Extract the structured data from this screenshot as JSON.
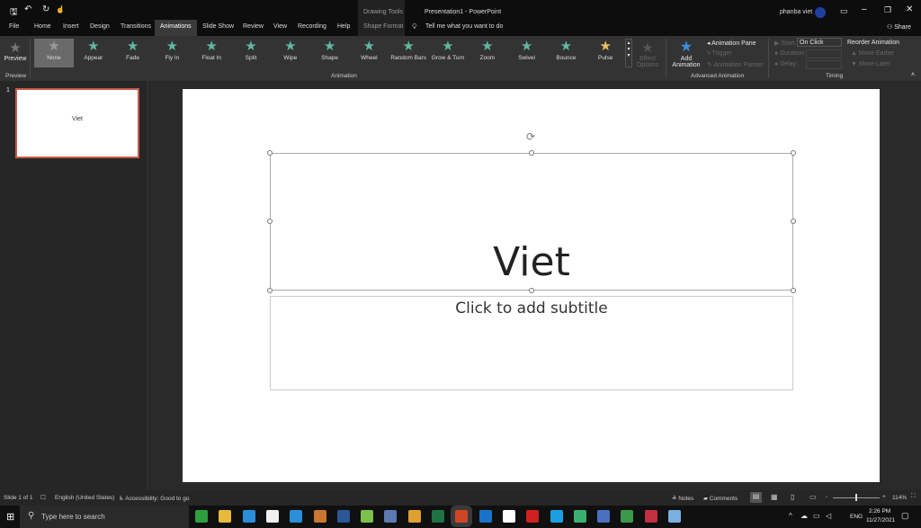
{
  "titlebar": {
    "qat": [
      "save-icon",
      "undo-icon",
      "redo-icon",
      "touch-mode-icon"
    ],
    "context_group": "Drawing Tools",
    "title": "Presentation1  -  PowerPoint",
    "user": "phanba viet",
    "share": "Share"
  },
  "tabs": [
    "File",
    "Home",
    "Insert",
    "Design",
    "Transitions",
    "Animations",
    "Slide Show",
    "Review",
    "View",
    "Recording",
    "Help",
    "Shape Format"
  ],
  "active_tab": "Animations",
  "tell_me": "Tell me what you want to do",
  "ribbon": {
    "preview_label": "Preview",
    "preview_group": "Preview",
    "animations": [
      "None",
      "Appear",
      "Fade",
      "Fly In",
      "Float In",
      "Split",
      "Wipe",
      "Shape",
      "Wheel",
      "Random Bars",
      "Grow & Turn",
      "Zoom",
      "Swivel",
      "Bounce",
      "Pulse"
    ],
    "effect_options": "Effect Options",
    "animation_group": "Animation",
    "add_animation": "Add Animation",
    "animation_pane": "Animation Pane",
    "trigger": "Trigger",
    "animation_painter": "Animation Painter",
    "advanced_group": "Advanced Animation",
    "start_label": "Start:",
    "start_value": "On Click",
    "duration_label": "Duration:",
    "delay_label": "Delay:",
    "reorder": "Reorder Animation",
    "move_earlier": "Move Earlier",
    "move_later": "Move Later",
    "timing_group": "Timing"
  },
  "thumbnail": {
    "number": "1",
    "text": "Viet"
  },
  "slide": {
    "title": "Viet",
    "subtitle": "Click to add subtitle"
  },
  "status": {
    "slide": "Slide 1 of 1",
    "language": "English (United States)",
    "accessibility": "Accessibility: Good to go",
    "notes": "Notes",
    "comments": "Comments",
    "zoom": "114%"
  },
  "taskbar": {
    "search_placeholder": "Type here to search",
    "lang": "ENG",
    "time": "2:26 PM",
    "date": "11/27/2021",
    "apps": [
      {
        "name": "camtasia",
        "color": "#2e9e3e"
      },
      {
        "name": "file-explorer",
        "color": "#e8b93a"
      },
      {
        "name": "edge",
        "color": "#2a8fd8"
      },
      {
        "name": "store",
        "color": "#f0f0f0"
      },
      {
        "name": "mail",
        "color": "#2a8fd8"
      },
      {
        "name": "app-orange",
        "color": "#c9762e"
      },
      {
        "name": "word",
        "color": "#2b5797"
      },
      {
        "name": "app-green",
        "color": "#7cc04a"
      },
      {
        "name": "app-photo",
        "color": "#5a7ab0"
      },
      {
        "name": "chrome",
        "color": "#e0a030"
      },
      {
        "name": "excel",
        "color": "#1f7244"
      },
      {
        "name": "powerpoint",
        "color": "#d04526"
      },
      {
        "name": "outlook",
        "color": "#1a73c8"
      },
      {
        "name": "app-m",
        "color": "#ffffff"
      },
      {
        "name": "recorder",
        "color": "#d02020"
      },
      {
        "name": "skype",
        "color": "#1aa0e0"
      },
      {
        "name": "app-circle",
        "color": "#3ab070"
      },
      {
        "name": "app-game",
        "color": "#4a70c0"
      },
      {
        "name": "app-map",
        "color": "#3a9a4a"
      },
      {
        "name": "app-red",
        "color": "#c03040"
      },
      {
        "name": "app-blue",
        "color": "#7ab0e0"
      }
    ]
  }
}
